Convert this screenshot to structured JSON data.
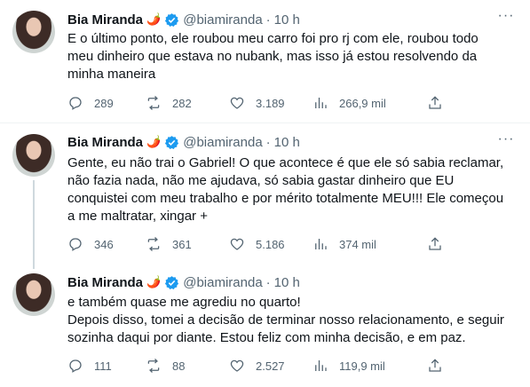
{
  "tweets": [
    {
      "name": "Bia Miranda",
      "emoji": "🌶️",
      "handle": "@biamiranda",
      "separator": "·",
      "time": "10 h",
      "more": "···",
      "lines": [
        "E o último ponto, ele roubou meu carro foi pro rj com ele, roubou todo",
        "meu dinheiro que estava no nubank, mas isso já estou resolvendo da",
        "minha maneira"
      ],
      "replies": "289",
      "retweets": "282",
      "likes": "3.189",
      "views": "266,9 mil"
    },
    {
      "name": "Bia Miranda",
      "emoji": "🌶️",
      "handle": "@biamiranda",
      "separator": "·",
      "time": "10 h",
      "more": "···",
      "lines": [
        "Gente, eu não trai o Gabriel! O que acontece é que ele só sabia reclamar,",
        "não fazia nada, não me ajudava, só sabia gastar dinheiro que EU",
        "conquistei com meu trabalho e por mérito totalmente MEU!!! Ele começou",
        "a me maltratar, xingar +"
      ],
      "replies": "346",
      "retweets": "361",
      "likes": "5.186",
      "views": "374 mil"
    },
    {
      "name": "Bia Miranda",
      "emoji": "🌶️",
      "handle": "@biamiranda",
      "separator": "·",
      "time": "10 h",
      "more": "···",
      "lines": [
        "e também quase me agrediu no quarto!",
        "Depois disso, tomei a decisão de terminar nosso relacionamento, e seguir",
        "sozinha daqui por diante. Estou feliz com minha decisão, e em paz."
      ],
      "replies": "111",
      "retweets": "88",
      "likes": "2.527",
      "views": "119,9 mil"
    }
  ],
  "colors": {
    "text": "#0f1419",
    "secondary": "#536471",
    "verified": "#1d9bf0",
    "divider": "#eff3f4"
  }
}
